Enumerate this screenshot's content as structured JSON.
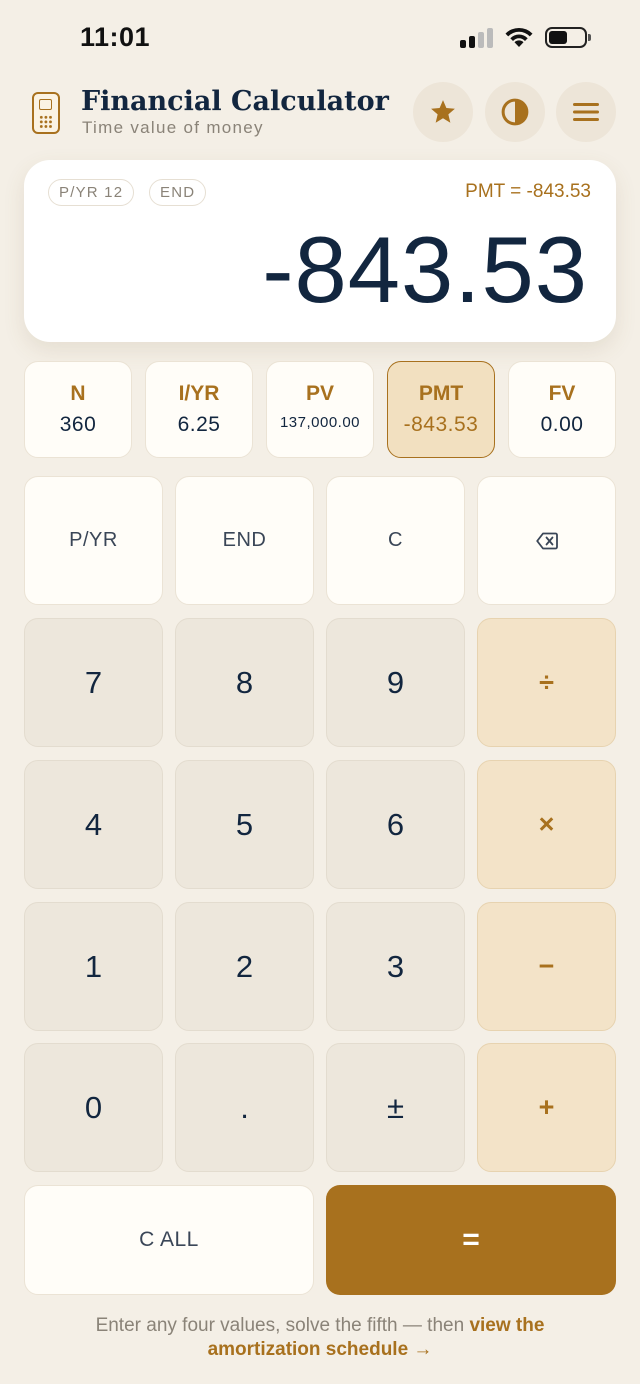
{
  "status_bar": {
    "time": "11:01"
  },
  "header": {
    "title": "Financial Calculator",
    "subtitle": "Time value of money",
    "buttons": [
      {
        "icon": "star-icon"
      },
      {
        "icon": "contrast-icon"
      },
      {
        "icon": "menu-icon"
      }
    ]
  },
  "display": {
    "pills": [
      "P/YR 12",
      "END"
    ],
    "result_label": "PMT = -843.53",
    "value": "-843.53"
  },
  "registers": [
    {
      "label": "N",
      "value": "360",
      "active": false
    },
    {
      "label": "I/YR",
      "value": "6.25",
      "active": false
    },
    {
      "label": "PV",
      "value": "137,000.00",
      "active": false
    },
    {
      "label": "PMT",
      "value": "-843.53",
      "active": true
    },
    {
      "label": "FV",
      "value": "0.00",
      "active": false
    }
  ],
  "keys": {
    "pyr": "P/YR",
    "end": "END",
    "clear": "C",
    "backspace_icon": "backspace-icon",
    "seven": "7",
    "eight": "8",
    "nine": "9",
    "divide": "÷",
    "four": "4",
    "five": "5",
    "six": "6",
    "multiply": "×",
    "one": "1",
    "two": "2",
    "three": "3",
    "subtract": "−",
    "zero": "0",
    "decimal": ".",
    "plus_minus": "±",
    "add": "+",
    "clear_all": "C ALL",
    "equals": "="
  },
  "footer": {
    "text": "Enter any four values, solve the fifth — then ",
    "link": "view the amortization schedule →"
  },
  "colors": {
    "accent": "#a8711e",
    "ink": "#12263f",
    "background": "#f4efe6"
  }
}
